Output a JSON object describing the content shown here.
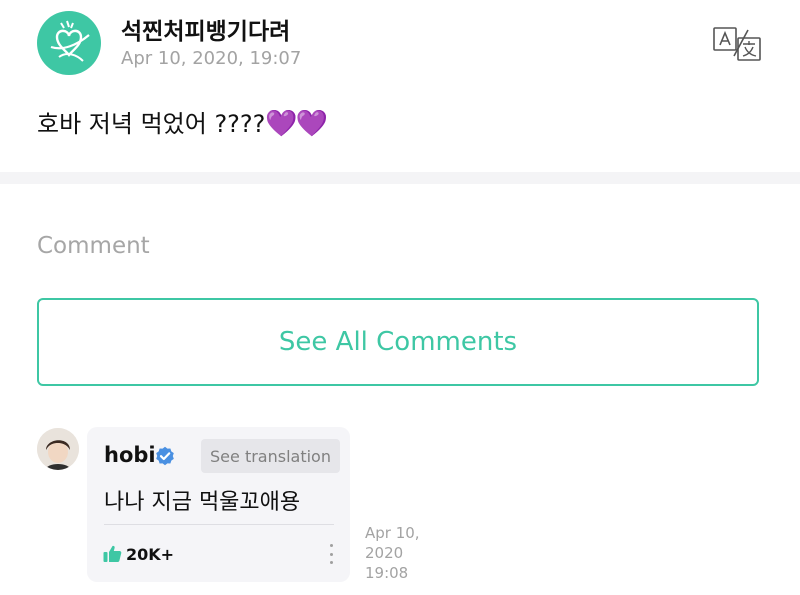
{
  "post": {
    "author": "석찐처피뱅기다려",
    "timestamp": "Apr 10, 2020, 19:07",
    "body_text": "호바 저녁 먹었어 ????",
    "hearts": "💜💜"
  },
  "comments_section": {
    "heading": "Comment",
    "see_all_label": "See All Comments"
  },
  "comment": {
    "author": "hobi",
    "see_translation_label": "See translation",
    "text": "나나 지금 먹울꼬애용",
    "likes": "20K+",
    "timestamp_line1": "Apr 10,",
    "timestamp_line2": "2020",
    "timestamp_line3": "19:08"
  },
  "colors": {
    "accent": "#3ec7a4",
    "heart": "#7b3fd8",
    "verified": "#4a90e2",
    "muted_text": "#a3a3a3"
  },
  "icons": {
    "post_avatar": "logo-avatar-icon",
    "translate": "translate-icon",
    "verified": "verified-badge-icon",
    "like": "thumbs-up-icon",
    "more": "more-vertical-icon"
  }
}
